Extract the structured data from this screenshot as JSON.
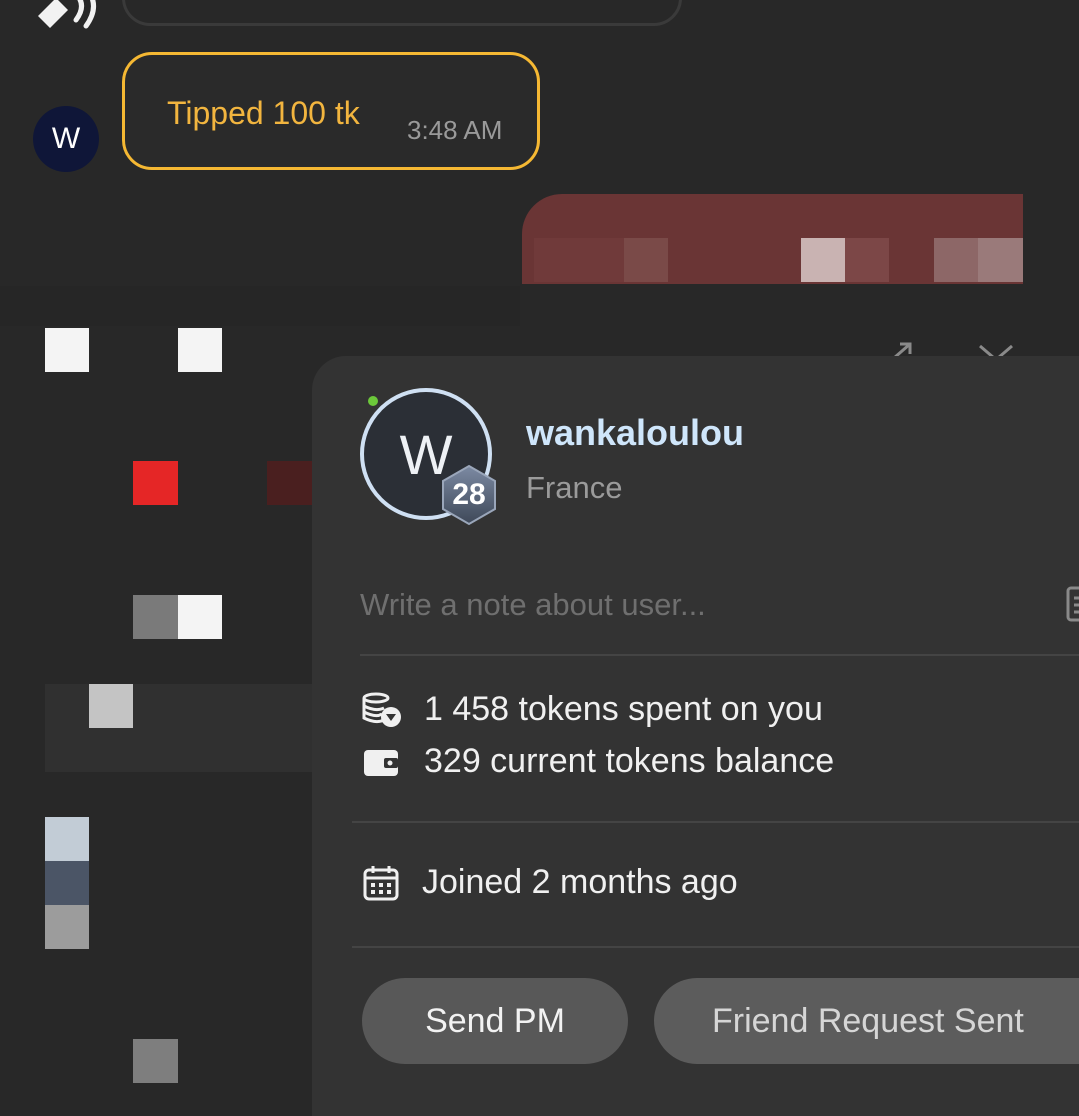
{
  "chat": {
    "tip_message": "Tipped 100 tk",
    "tip_time": "3:48 AM",
    "sender_avatar_letter": "W"
  },
  "profile": {
    "avatar_letter": "W",
    "level": "28",
    "username": "wankaloulou",
    "country": "France",
    "online": true,
    "note_placeholder": "Write a note about user...",
    "stats": {
      "spent": "1 458 tokens spent on you",
      "balance": "329 current tokens balance"
    },
    "joined": "Joined 2 months ago",
    "buttons": {
      "send_pm": "Send PM",
      "friend_request": "Friend Request Sent"
    }
  },
  "colors": {
    "tip_accent": "#f5b833",
    "username": "#cfe6fb",
    "online": "#6cc83a"
  }
}
